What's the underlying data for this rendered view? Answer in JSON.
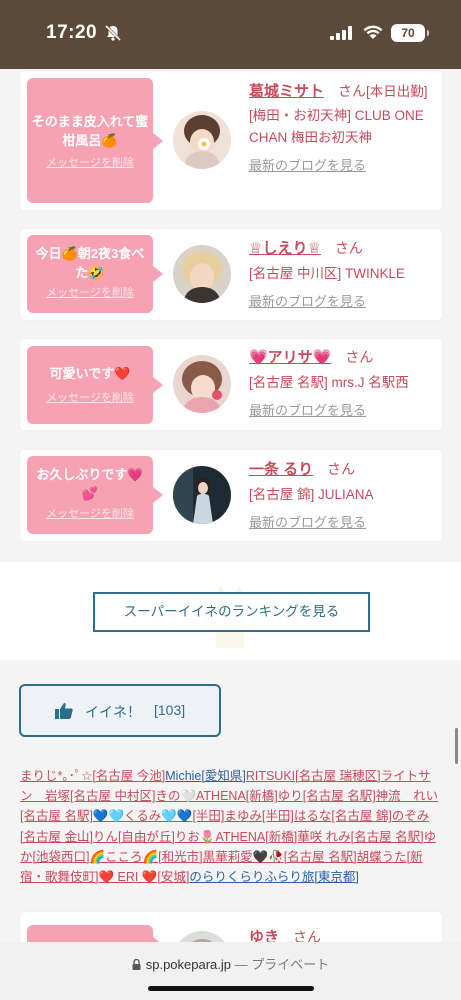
{
  "status": {
    "time": "17:20",
    "battery": "70"
  },
  "cards": [
    {
      "message": "そのまま皮入れて蜜柑風呂🍊",
      "delete": "メッセージを削除",
      "name": "葛城ミサト",
      "san": "さん",
      "shop": "[本日出勤]\n[梅田・お初天神] CLUB ONE CHAN 梅田お初天神",
      "blog": "最新のブログを見る"
    },
    {
      "message": "今日🍊朝2夜3食べた🤣",
      "delete": "メッセージを削除",
      "name": "♕しえり♕",
      "san": "さん",
      "shop": "[名古屋 中川区] TWINKLE",
      "blog": "最新のブログを見る"
    },
    {
      "message": "可愛いです❤️",
      "delete": "メッセージを削除",
      "name": "💗アリサ💗",
      "san": "さん",
      "shop": "[名古屋 名駅] mrs.J 名駅西",
      "blog": "最新のブログを見る"
    },
    {
      "message": "お久しぶりです💗💕",
      "delete": "メッセージを削除",
      "name": "一条 るり",
      "san": "さん",
      "shop": "[名古屋 錦] JULIANA",
      "blog": "最新のブログを見る"
    },
    {
      "message": "",
      "delete": "",
      "name": "ゆき",
      "san": "さん",
      "shop": "",
      "blog": ""
    }
  ],
  "ranking_label": "スーパーイイネのランキングを見る",
  "like": {
    "label": "イイネ！",
    "count": "[103]"
  },
  "likers": [
    {
      "t": "まりじ*｡･ﾟ☆",
      "c": "p"
    },
    {
      "t": "[名古屋 今池]",
      "c": "p"
    },
    {
      "t": "Michie",
      "c": "b"
    },
    {
      "t": "[愛知県]",
      "c": "b"
    },
    {
      "t": "RITSUKI",
      "c": "p"
    },
    {
      "t": "[名古屋 瑞穂区]",
      "c": "p"
    },
    {
      "t": "ライトサン　岩塚",
      "c": "p"
    },
    {
      "t": "[名古屋 中村区]",
      "c": "p"
    },
    {
      "t": "きの🤍ATHENA",
      "c": "p"
    },
    {
      "t": "[新橋]",
      "c": "p"
    },
    {
      "t": "ゆり",
      "c": "p"
    },
    {
      "t": "[名古屋 名駅]",
      "c": "p"
    },
    {
      "t": "神流　れい",
      "c": "p"
    },
    {
      "t": "[名古屋 名駅]",
      "c": "p"
    },
    {
      "t": "💙🩵くるみ🩵💙",
      "c": "p"
    },
    {
      "t": "[半田]",
      "c": "p"
    },
    {
      "t": "まゆみ",
      "c": "p"
    },
    {
      "t": "[半田]",
      "c": "p"
    },
    {
      "t": "はるな",
      "c": "p"
    },
    {
      "t": "[名古屋 錦]",
      "c": "p"
    },
    {
      "t": "のぞみ",
      "c": "p"
    },
    {
      "t": "[名古屋 金山]",
      "c": "p"
    },
    {
      "t": "りん",
      "c": "p"
    },
    {
      "t": "[自由が丘]",
      "c": "p"
    },
    {
      "t": "りお🌷ATHENA",
      "c": "p"
    },
    {
      "t": "[新橋]",
      "c": "p"
    },
    {
      "t": "華咲 れみ",
      "c": "p"
    },
    {
      "t": "[名古屋 名駅]",
      "c": "p"
    },
    {
      "t": "ゆか",
      "c": "p"
    },
    {
      "t": "[池袋西口]",
      "c": "p"
    },
    {
      "t": "🌈こころ🌈",
      "c": "p"
    },
    {
      "t": "[和光市]",
      "c": "p"
    },
    {
      "t": "黒華莉愛🖤🥀",
      "c": "p"
    },
    {
      "t": "[名古屋 名駅]",
      "c": "p"
    },
    {
      "t": "胡蝶うた",
      "c": "p"
    },
    {
      "t": "[新宿・歌舞伎町]",
      "c": "p"
    },
    {
      "t": "❤️ ERI ❤️",
      "c": "p"
    },
    {
      "t": "[安城]",
      "c": "p"
    },
    {
      "t": "のらりくらりふらり旅",
      "c": "b"
    },
    {
      "t": "[東京都]",
      "c": "b"
    }
  ],
  "browser": {
    "domain": "sp.pokepara.jp",
    "sep": "— プライベート"
  }
}
